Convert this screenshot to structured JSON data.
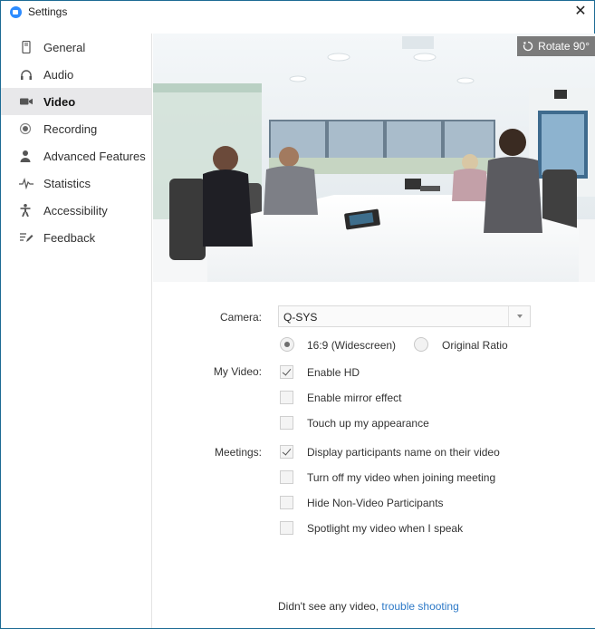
{
  "window": {
    "title": "Settings",
    "app_icon": "zoom-camera-icon",
    "close_glyph": "✕"
  },
  "sidebar": {
    "items": [
      {
        "label": "General",
        "icon": "phone-icon",
        "active": false
      },
      {
        "label": "Audio",
        "icon": "headphones-icon",
        "active": false
      },
      {
        "label": "Video",
        "icon": "video-camera-icon",
        "active": true
      },
      {
        "label": "Recording",
        "icon": "record-icon",
        "active": false
      },
      {
        "label": "Advanced Features",
        "icon": "person-icon",
        "active": false
      },
      {
        "label": "Statistics",
        "icon": "pulse-icon",
        "active": false
      },
      {
        "label": "Accessibility",
        "icon": "accessibility-icon",
        "active": false
      },
      {
        "label": "Feedback",
        "icon": "feedback-icon",
        "active": false
      }
    ]
  },
  "preview": {
    "rotate_label": "Rotate 90°",
    "rotate_icon": "rotate-icon"
  },
  "camera": {
    "label": "Camera:",
    "selected": "Q-SYS"
  },
  "aspect": {
    "options": [
      {
        "label": "16:9 (Widescreen)",
        "checked": true
      },
      {
        "label": "Original Ratio",
        "checked": false
      }
    ]
  },
  "my_video": {
    "label": "My Video:",
    "options": [
      {
        "label": "Enable HD",
        "checked": true
      },
      {
        "label": "Enable mirror effect",
        "checked": false
      },
      {
        "label": "Touch up my appearance",
        "checked": false
      }
    ]
  },
  "meetings": {
    "label": "Meetings:",
    "options": [
      {
        "label": "Display participants name on their video",
        "checked": true
      },
      {
        "label": "Turn off my video when joining meeting",
        "checked": false
      },
      {
        "label": "Hide Non-Video Participants",
        "checked": false
      },
      {
        "label": "Spotlight my video when I speak",
        "checked": false
      }
    ]
  },
  "footer": {
    "text": "Didn't see any video,",
    "link": "trouble shooting"
  },
  "colors": {
    "accent": "#2d8cff",
    "link": "#2d79c7",
    "active_bg": "#e8e8ea",
    "border": "#1c6b94"
  }
}
